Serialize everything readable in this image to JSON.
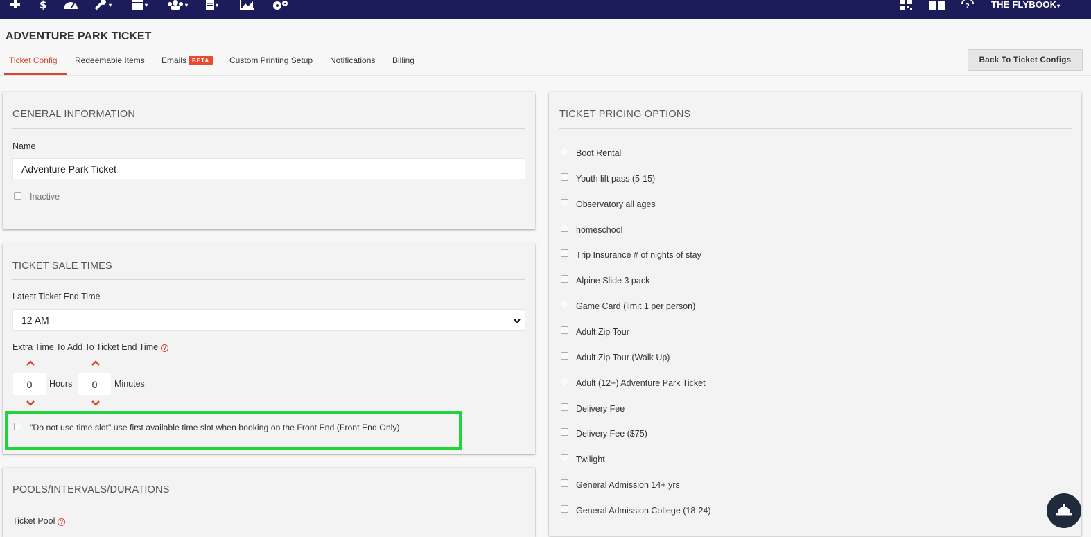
{
  "topbar": {
    "icons": [
      "plus-icon",
      "dollar-icon",
      "dashboard-icon",
      "wrench-icon",
      "calendar-icon",
      "users-icon",
      "document-icon",
      "chart-icon",
      "gears-icon"
    ],
    "right_icons": [
      "qr-icon",
      "book-icon",
      "help-icon"
    ],
    "brand": "THE FLYBOOK",
    "colors": {
      "bar": "#1c1c5a",
      "accent": "#d9452b",
      "highlight": "#22d43a"
    }
  },
  "page": {
    "title": "ADVENTURE PARK TICKET",
    "back_button": "Back To Ticket Configs"
  },
  "tabs": [
    {
      "label": "Ticket Config",
      "active": true
    },
    {
      "label": "Redeemable Items"
    },
    {
      "label": "Emails",
      "badge": "BETA"
    },
    {
      "label": "Custom Printing Setup"
    },
    {
      "label": "Notifications"
    },
    {
      "label": "Billing"
    }
  ],
  "general": {
    "title": "GENERAL INFORMATION",
    "name_label": "Name",
    "name_value": "Adventure Park Ticket",
    "inactive_label": "Inactive"
  },
  "sale_times": {
    "title": "TICKET SALE TIMES",
    "latest_end_label": "Latest Ticket End Time",
    "latest_end_value": "12 AM",
    "extra_time_label": "Extra Time To Add To Ticket End Time",
    "hours_value": "0",
    "hours_label": "Hours",
    "minutes_value": "0",
    "minutes_label": "Minutes",
    "time_slot_label": "\"Do not use time slot\" use first available time slot when booking on the Front End (Front End Only)"
  },
  "pools": {
    "title": "POOLS/INTERVALS/DURATIONS",
    "ticket_pool_label": "Ticket Pool"
  },
  "pricing": {
    "title": "TICKET PRICING OPTIONS",
    "options": [
      "Boot Rental",
      "Youth lift pass (5-15)",
      "Observatory all ages",
      "homeschool",
      "Trip Insurance # of nights of stay",
      "Alpine Slide 3 pack",
      "Game Card (limit 1 per person)",
      "Adult Zip Tour",
      "Adult Zip Tour (Walk Up)",
      "Adult (12+) Adventure Park Ticket",
      "Delivery Fee",
      "Delivery Fee ($75)",
      "Twilight",
      "General Admission 14+ yrs",
      "General Admission College (18-24)"
    ]
  }
}
